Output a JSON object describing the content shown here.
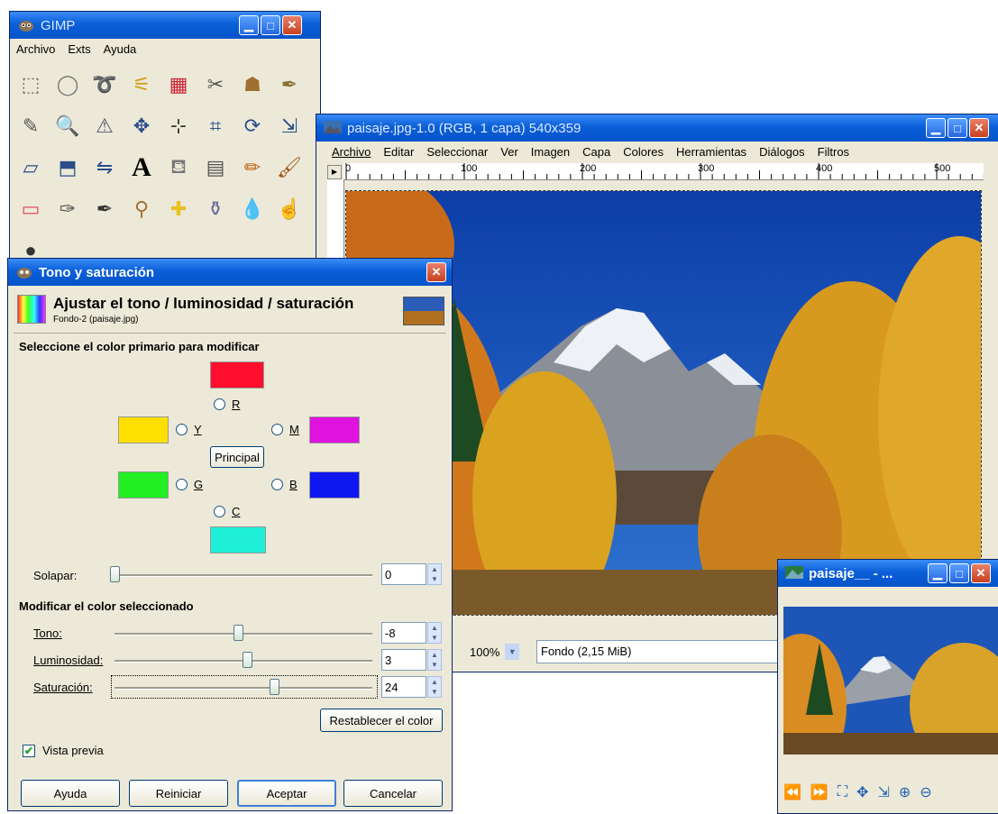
{
  "toolbox": {
    "title": "GIMP",
    "menu": [
      "Archivo",
      "Exts",
      "Ayuda"
    ],
    "tools": [
      "rect-select",
      "ellipse-select",
      "free-select",
      "fuzzy-select",
      "color-select",
      "scissors",
      "foreground-select",
      "paths",
      "color-picker",
      "zoom",
      "measure",
      "move",
      "align",
      "crop",
      "rotate",
      "scale",
      "shear",
      "perspective",
      "flip",
      "text",
      "bucket-fill",
      "blend",
      "pencil",
      "paintbrush",
      "eraser",
      "airbrush",
      "ink",
      "clone",
      "heal",
      "perspective-clone",
      "blur",
      "smudge",
      "dodge-burn"
    ]
  },
  "image_window": {
    "title": "paisaje.jpg-1.0 (RGB, 1 capa) 540x359",
    "menu": [
      "Archivo",
      "Editar",
      "Seleccionar",
      "Ver",
      "Imagen",
      "Capa",
      "Colores",
      "Herramientas",
      "Diálogos",
      "Filtros"
    ],
    "ruler_ticks": [
      "0",
      "100",
      "200",
      "300",
      "400",
      "500"
    ],
    "zoom": "100%",
    "status": "Fondo (2,15 MiB)"
  },
  "dialog": {
    "title": "Tono y saturación",
    "header_title": "Ajustar el tono / luminosidad / saturación",
    "header_sub": "Fondo-2 (paisaje.jpg)",
    "section_select": "Seleccione el color primario para modificar",
    "colors": {
      "R": "#ff0f2d",
      "Y": "#ffdf00",
      "M": "#e012e0",
      "G": "#22ee22",
      "B": "#0e17ef",
      "C": "#1fefd6"
    },
    "radio_labels": {
      "R": "R",
      "Y": "Y",
      "M": "M",
      "G": "G",
      "B": "B",
      "C": "C"
    },
    "principal": "Principal",
    "overlap_label": "Solapar:",
    "overlap_value": "0",
    "overlap_level": 0,
    "section_modify": "Modificar el color seleccionado",
    "hue_label": "Tono:",
    "hue_value": "-8",
    "hue_level": -8,
    "lightness_label": "Luminosidad:",
    "lightness_value": "3",
    "lightness_level": 3,
    "saturation_label": "Saturación:",
    "saturation_value": "24",
    "saturation_level": 24,
    "reset_color": "Restablecer el color",
    "preview_label": "Vista previa",
    "preview_checked": true,
    "buttons": {
      "help": "Ayuda",
      "reset": "Reiniciar",
      "ok": "Aceptar",
      "cancel": "Cancelar"
    }
  },
  "navigator": {
    "title": "paisaje__ - ..."
  }
}
